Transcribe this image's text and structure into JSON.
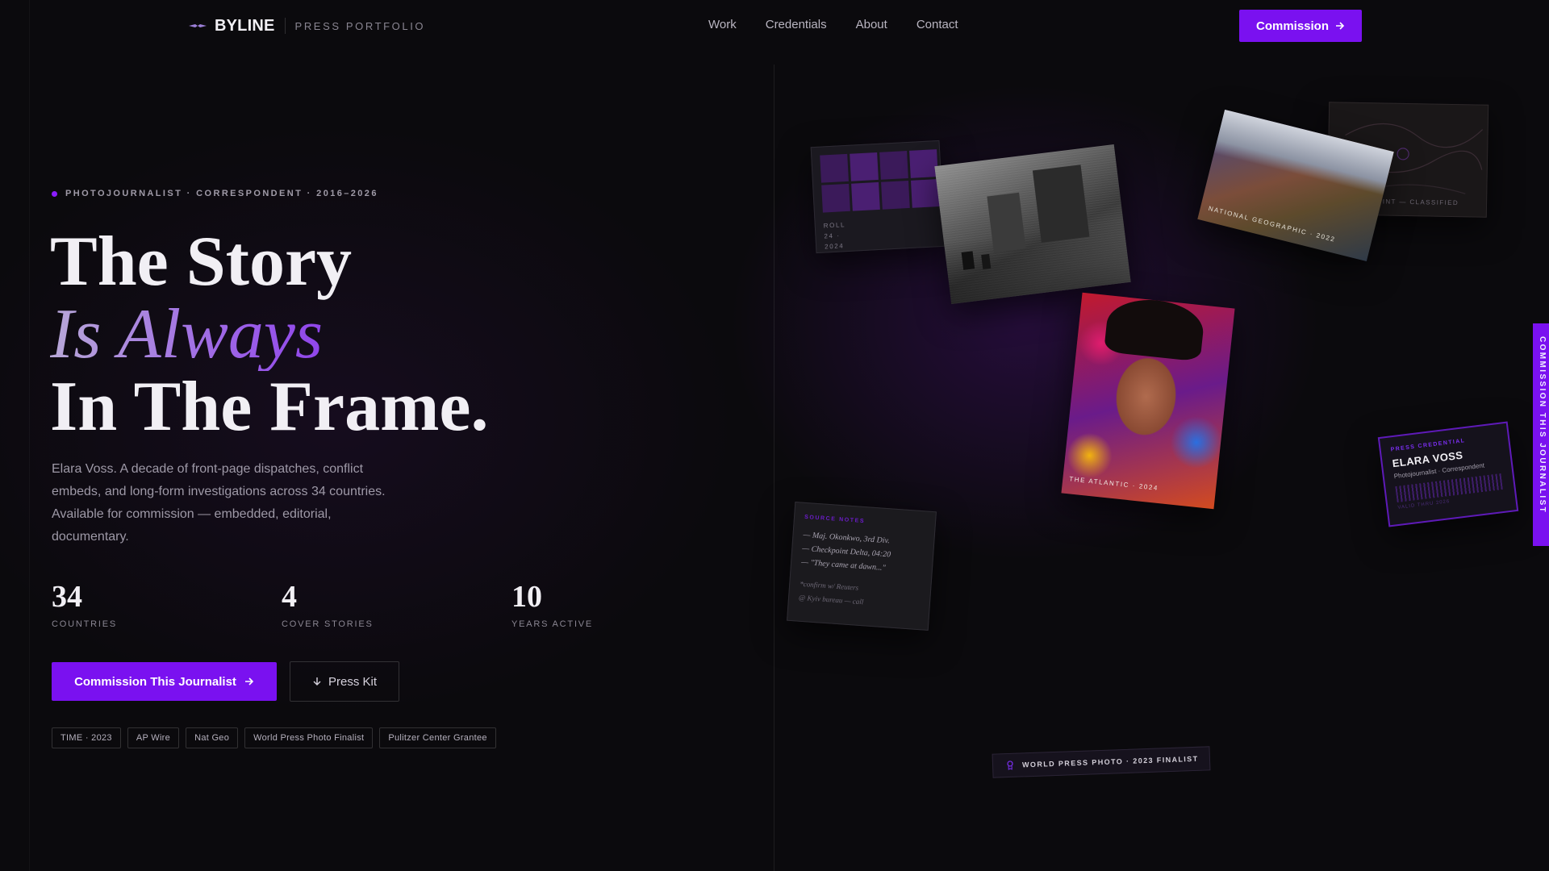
{
  "nav": {
    "brand": "BYLINE",
    "brand_sub": "PRESS PORTFOLIO",
    "links": [
      "Work",
      "Credentials",
      "About",
      "Contact"
    ],
    "cta": "Commission"
  },
  "hero": {
    "eyebrow": "PHOTOJOURNALIST · CORRESPONDENT · 2016–2026",
    "headline_1": "The Story",
    "headline_2": "Is Always",
    "headline_3": "In The Frame.",
    "lede": "Elara Voss. A decade of front-page dispatches, conflict embeds, and long-form investigations across 34 countries. Available for commission — embedded, editorial, documentary.",
    "stats": [
      {
        "value": "34",
        "label": "COUNTRIES"
      },
      {
        "value": "4",
        "label": "COVER STORIES"
      },
      {
        "value": "10",
        "label": "YEARS ACTIVE"
      }
    ],
    "primary_cta": "Commission This Journalist",
    "secondary_cta": "Press Kit",
    "tags": [
      "TIME · 2023",
      "AP Wire",
      "Nat Geo",
      "World Press Photo Finalist",
      "Pulitzer Center Grantee"
    ]
  },
  "collage": {
    "contact_sheet": "ROLL 24 · 2024",
    "landscape_caption": "NATIONAL GEOGRAPHIC · 2022",
    "map_caption": "INT — CLASSIFIED",
    "portrait_caption": "THE ATLANTIC · 2024",
    "notes": {
      "heading": "SOURCE NOTES",
      "lines": [
        "— Maj. Okonkwo, 3rd Div.",
        "— Checkpoint Delta, 04:20",
        "— \"They came at dawn...\""
      ],
      "extra": [
        "*confirm w/ Reuters",
        "@ Kyiv bureau — call"
      ]
    },
    "credential": {
      "kicker": "PRESS CREDENTIAL",
      "name": "ELARA VOSS",
      "role": "Photojournalist · Correspondent",
      "expiry": "VALID THRU 2026"
    },
    "ribbon": "WORLD PRESS PHOTO · 2023 FINALIST"
  },
  "side_tab": "COMMISSION THIS JOURNALIST",
  "colors": {
    "accent": "#7a11f0",
    "background": "#0b0a0d"
  },
  "icons": [
    "brand-mark-icon",
    "arrow-right-icon",
    "arrow-down-icon",
    "medal-icon"
  ]
}
